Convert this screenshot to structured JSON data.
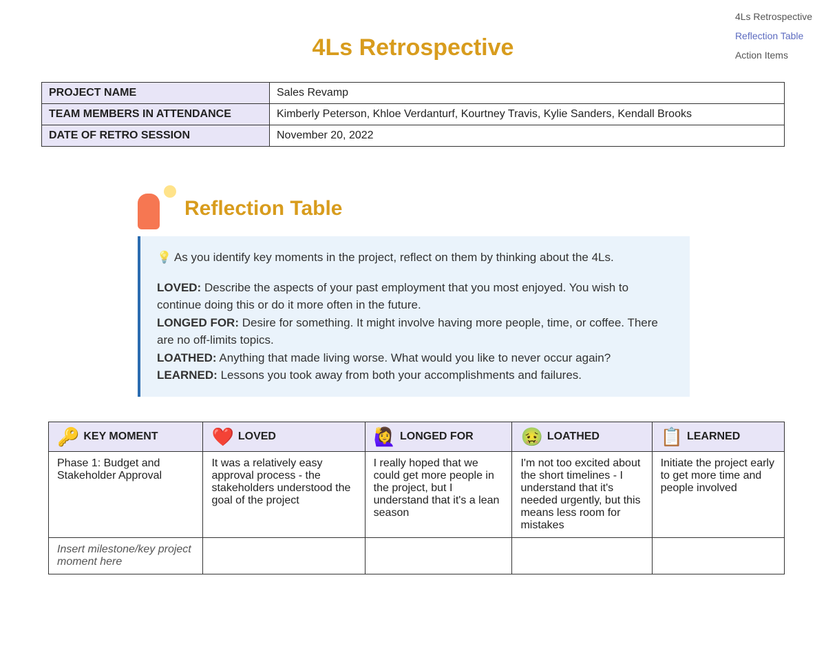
{
  "nav": {
    "items": [
      {
        "label": "4Ls Retrospective",
        "active": false
      },
      {
        "label": "Reflection Table",
        "active": true
      },
      {
        "label": "Action Items",
        "active": false
      }
    ]
  },
  "title": "4Ls Retrospective",
  "meta": {
    "rows": [
      {
        "label": "PROJECT NAME",
        "value": "Sales Revamp"
      },
      {
        "label": "TEAM MEMBERS IN ATTENDANCE",
        "value": "Kimberly Peterson, Khloe Verdanturf, Kourtney Travis, Kylie Sanders, Kendall Brooks"
      },
      {
        "label": "DATE OF RETRO SESSION",
        "value": "November 20, 2022"
      }
    ]
  },
  "reflection": {
    "heading": "Reflection Table",
    "callout": {
      "lead": "As you identify key moments in the project, reflect on them by thinking about the 4Ls.",
      "defs": [
        {
          "term": "LOVED:",
          "body": "Describe the aspects of your past employment that you most enjoyed. You wish to continue doing this or do it more often in the future."
        },
        {
          "term": "LONGED FOR:",
          "body": "Desire for something.  It might involve having more people, time, or coffee. There are no off-limits topics."
        },
        {
          "term": "LOATHED:",
          "body": "Anything that made living worse. What would you like to never occur again?"
        },
        {
          "term": "LEARNED:",
          "body": "Lessons you took away from both your accomplishments and failures."
        }
      ]
    },
    "columns": [
      {
        "icon": "🔑",
        "label": "KEY MOMENT"
      },
      {
        "icon": "❤️",
        "label": "LOVED"
      },
      {
        "icon": "🙋‍♀️",
        "label": "LONGED FOR"
      },
      {
        "icon": "🤢",
        "label": "LOATHED"
      },
      {
        "icon": "📋",
        "label": "LEARNED"
      }
    ],
    "rows": [
      {
        "cells": [
          "Phase 1: Budget and Stakeholder Approval",
          "It was a relatively easy approval process - the stakeholders understood the goal of the project",
          "I really hoped that we could get more people in the project, but I understand that it's a lean season",
          "I'm not too excited about the short timelines - I understand that it's needed urgently, but this means less room for mistakes",
          "Initiate the project early to get more time and people involved"
        ],
        "placeholder": false
      },
      {
        "cells": [
          "Insert milestone/key project moment here",
          "",
          "",
          "",
          ""
        ],
        "placeholder": true
      }
    ]
  }
}
